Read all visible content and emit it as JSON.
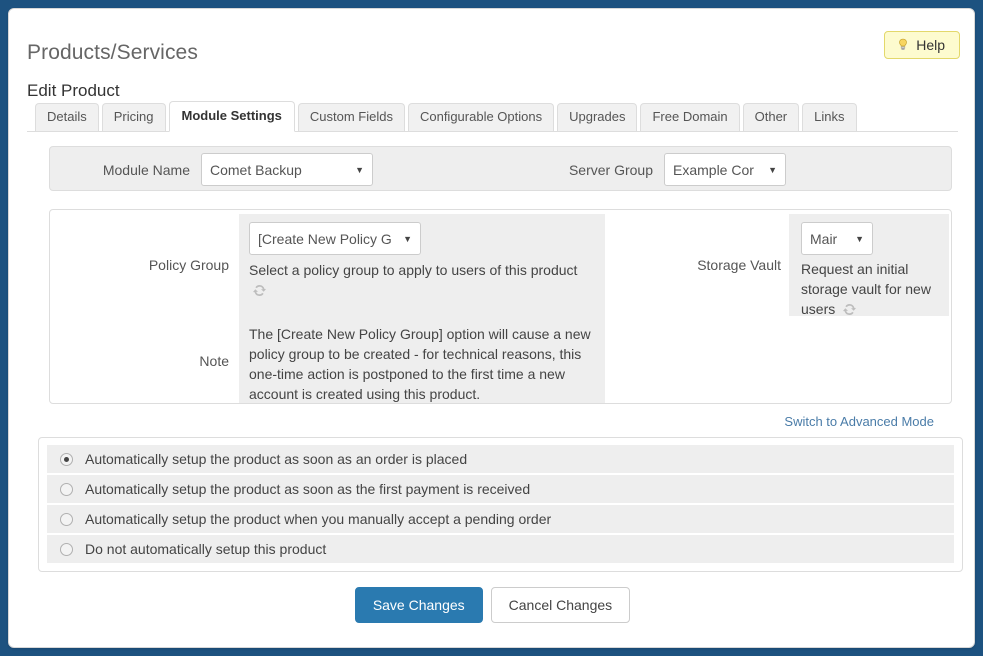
{
  "header": {
    "page_title": "Products/Services",
    "subtitle": "Edit Product",
    "help_label": "Help",
    "help_icon": "lightbulb-icon"
  },
  "tabs": [
    {
      "label": "Details",
      "active": false
    },
    {
      "label": "Pricing",
      "active": false
    },
    {
      "label": "Module Settings",
      "active": true
    },
    {
      "label": "Custom Fields",
      "active": false
    },
    {
      "label": "Configurable Options",
      "active": false
    },
    {
      "label": "Upgrades",
      "active": false
    },
    {
      "label": "Free Domain",
      "active": false
    },
    {
      "label": "Other",
      "active": false
    },
    {
      "label": "Links",
      "active": false
    }
  ],
  "module_row": {
    "module_name_label": "Module Name",
    "module_name_value": "Comet Backup",
    "server_group_label": "Server Group",
    "server_group_value": "Example Cor"
  },
  "fields": {
    "policy_group": {
      "label": "Policy Group",
      "value": "[Create New Policy G",
      "helper": "Select a policy group to apply to users of this product",
      "refresh_icon": "refresh-icon"
    },
    "note": {
      "label": "Note",
      "text": "The [Create New Policy Group] option will cause a new policy group to be created - for technical reasons, this one-time action is postponed to the first time a new account is created using this product."
    },
    "storage_vault": {
      "label": "Storage Vault",
      "value": "Mair",
      "helper": "Request an initial storage vault for new users",
      "refresh_icon": "refresh-icon"
    }
  },
  "advanced_link": "Switch to Advanced Mode",
  "setup_options": [
    {
      "label": "Automatically setup the product as soon as an order is placed",
      "checked": true
    },
    {
      "label": "Automatically setup the product as soon as the first payment is received",
      "checked": false
    },
    {
      "label": "Automatically setup the product when you manually accept a pending order",
      "checked": false
    },
    {
      "label": "Do not automatically setup this product",
      "checked": false
    }
  ],
  "footer": {
    "save_label": "Save Changes",
    "cancel_label": "Cancel Changes"
  },
  "colors": {
    "page_background": "#1d5280",
    "primary_button": "#2a7ab0",
    "link": "#4a7ca8",
    "help_bg": "#fdfbcf",
    "help_border": "#e3d86b",
    "field_bg": "#eeeeee"
  }
}
